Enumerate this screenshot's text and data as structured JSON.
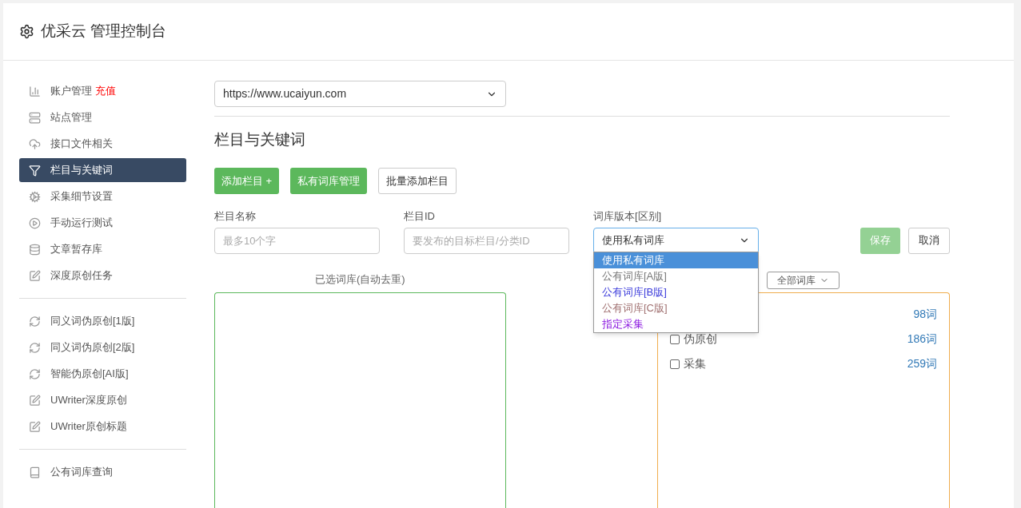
{
  "header": {
    "title": "优采云 管理控制台"
  },
  "sidebar": {
    "groups": [
      [
        {
          "label": "账户管理",
          "badge": "充值",
          "selected": false
        },
        {
          "label": "站点管理",
          "selected": false
        },
        {
          "label": "接口文件相关",
          "selected": false
        },
        {
          "label": "栏目与关键词",
          "selected": true
        },
        {
          "label": "采集细节设置",
          "selected": false
        },
        {
          "label": "手动运行测试",
          "selected": false
        },
        {
          "label": "文章暂存库",
          "selected": false
        },
        {
          "label": "深度原创任务",
          "selected": false
        }
      ],
      [
        {
          "label": "同义词伪原创[1版]",
          "selected": false
        },
        {
          "label": "同义词伪原创[2版]",
          "selected": false
        },
        {
          "label": "智能伪原创[AI版]",
          "selected": false
        },
        {
          "label": "UWriter深度原创",
          "selected": false
        },
        {
          "label": "UWriter原创标题",
          "selected": false
        }
      ],
      [
        {
          "label": "公有词库查询",
          "selected": false
        }
      ]
    ]
  },
  "site_select": {
    "value": "https://www.ucaiyun.com"
  },
  "section_title": "栏目与关键词",
  "actions": [
    {
      "label": "添加栏目 +",
      "kind": "primary"
    },
    {
      "label": "私有词库管理",
      "kind": "primary"
    },
    {
      "label": "批量添加栏目",
      "kind": "default"
    }
  ],
  "form": {
    "fields": [
      {
        "label": "栏目名称",
        "placeholder": "最多10个字"
      },
      {
        "label": "栏目ID",
        "placeholder": "要发布的目标栏目/分类ID"
      }
    ],
    "version": {
      "label": "词库版本[区别]",
      "value": "使用私有词库",
      "expanded": true,
      "options": [
        {
          "label": "使用私有词库",
          "selected": true,
          "color": "#ffffff"
        },
        {
          "label": "公有词库[A版]",
          "selected": false,
          "color": "#777777"
        },
        {
          "label": "公有词库[B版]",
          "selected": false,
          "color": "#3b3bdb"
        },
        {
          "label": "公有词库[C版]",
          "selected": false,
          "color": "#a07070"
        },
        {
          "label": "指定采集",
          "selected": false,
          "color": "#8a16e0"
        }
      ]
    },
    "save": {
      "label": "保存",
      "disabled": true
    },
    "cancel": {
      "label": "取消"
    }
  },
  "selected_panel": {
    "title": "已选词库(自动去重)"
  },
  "library_filter": {
    "value": "全部词库"
  },
  "libraries": [
    {
      "count": "98词"
    },
    {
      "name": "伪原创",
      "count": "186词",
      "checked": false
    },
    {
      "name": "采集",
      "count": "259词",
      "checked": false
    }
  ]
}
